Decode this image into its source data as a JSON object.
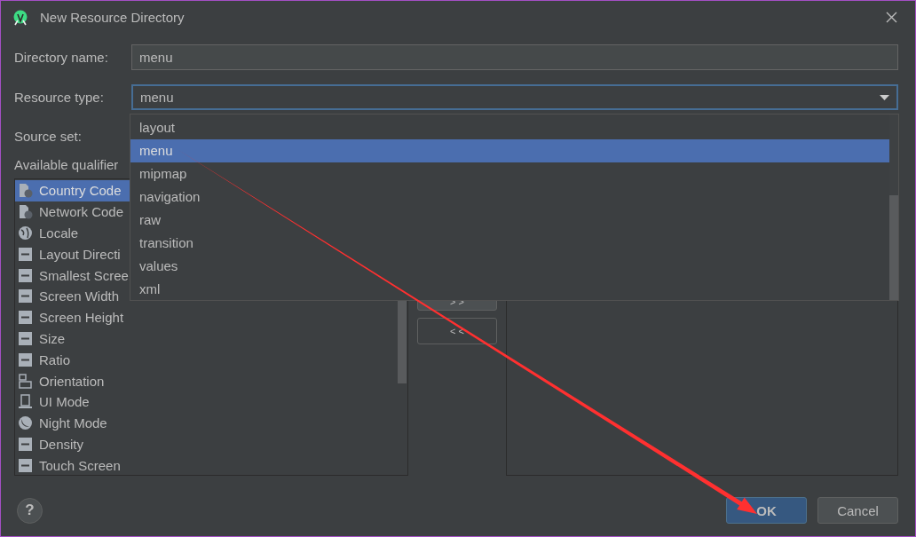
{
  "window": {
    "title": "New Resource Directory"
  },
  "directory_name": {
    "label": "Directory name:",
    "value": "menu"
  },
  "resource_type": {
    "label": "Resource type:",
    "value": "menu",
    "options": [
      {
        "label": "layout",
        "selected": false
      },
      {
        "label": "menu",
        "selected": true
      },
      {
        "label": "mipmap",
        "selected": false
      },
      {
        "label": "navigation",
        "selected": false
      },
      {
        "label": "raw",
        "selected": false
      },
      {
        "label": "transition",
        "selected": false
      },
      {
        "label": "values",
        "selected": false
      },
      {
        "label": "xml",
        "selected": false
      }
    ]
  },
  "source_set": {
    "label": "Source set:"
  },
  "qualifiers": {
    "label": "Available qualifier",
    "items": [
      {
        "label": "Country Code",
        "selected": true
      },
      {
        "label": "Network Code",
        "selected": false
      },
      {
        "label": "Locale",
        "selected": false
      },
      {
        "label": "Layout Directi",
        "selected": false
      },
      {
        "label": "Smallest Scree",
        "selected": false
      },
      {
        "label": "Screen Width",
        "selected": false
      },
      {
        "label": "Screen Height",
        "selected": false
      },
      {
        "label": "Size",
        "selected": false
      },
      {
        "label": "Ratio",
        "selected": false
      },
      {
        "label": "Orientation",
        "selected": false
      },
      {
        "label": "UI Mode",
        "selected": false
      },
      {
        "label": "Night Mode",
        "selected": false
      },
      {
        "label": "Density",
        "selected": false
      },
      {
        "label": "Touch Screen",
        "selected": false
      }
    ]
  },
  "move_buttons": [
    "> >",
    "< <"
  ],
  "help": {
    "label": "?"
  },
  "buttons": [
    {
      "label": "OK",
      "kind": "primary"
    },
    {
      "label": "Cancel",
      "kind": "secondary"
    }
  ]
}
